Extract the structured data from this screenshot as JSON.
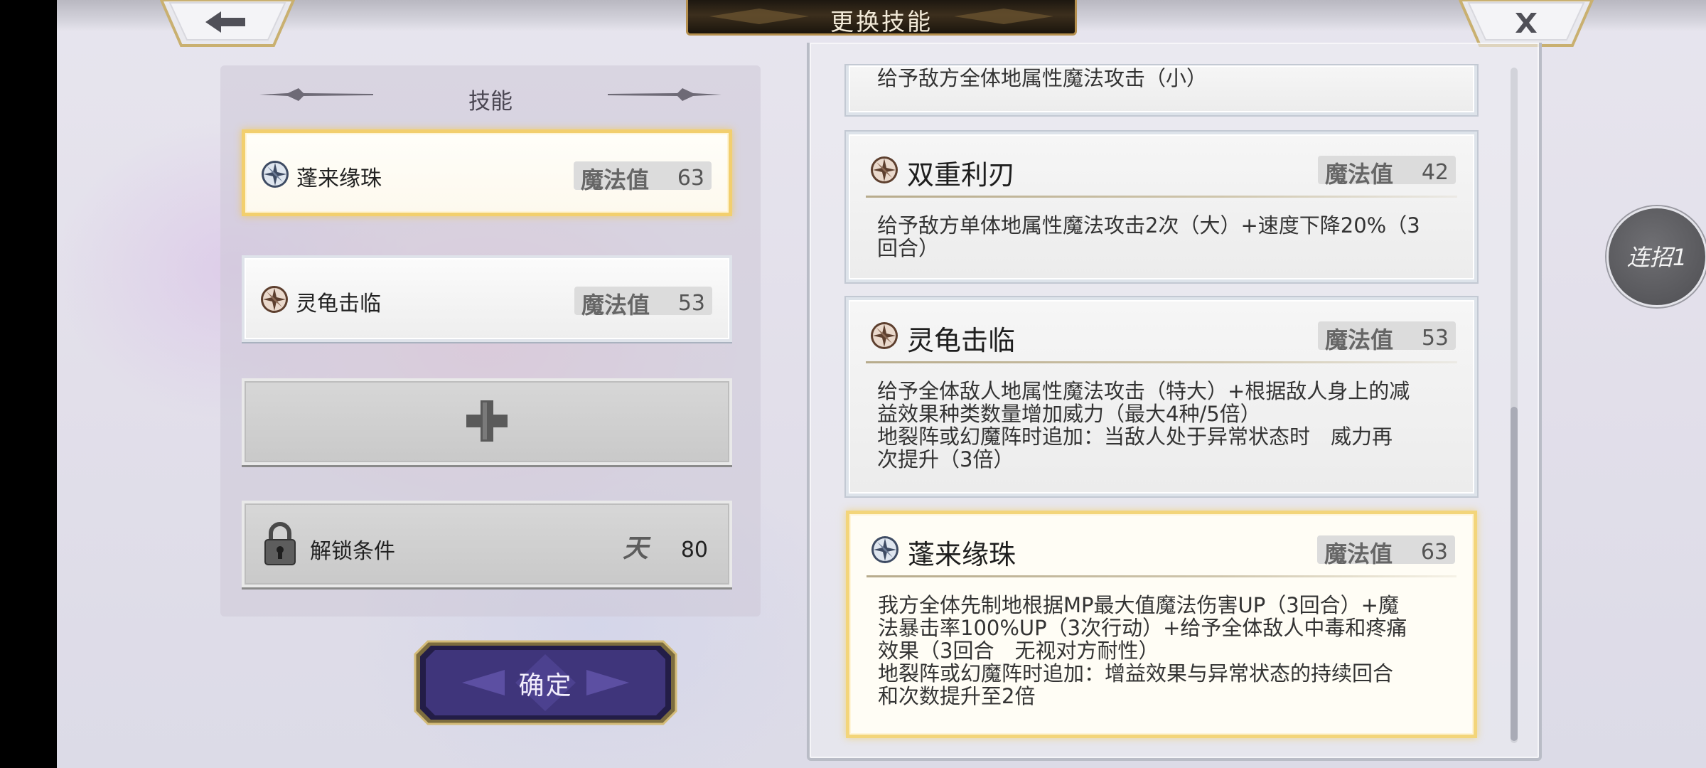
{
  "header": {
    "title": "更换技能"
  },
  "left_panel": {
    "title": "技能",
    "slots": [
      {
        "name": "蓬来缘珠",
        "mp_label": "魔法值",
        "mp": "63",
        "selected": true,
        "icon": "compass-star-blue-icon"
      },
      {
        "name": "灵龟击临",
        "mp_label": "魔法值",
        "mp": "53",
        "selected": false,
        "icon": "compass-star-brown-icon"
      }
    ],
    "add_slot": {
      "icon": "plus-icon"
    },
    "locked_slot": {
      "label": "解锁条件",
      "rank_icon": "天",
      "value": "80"
    },
    "confirm_label": "确定"
  },
  "skill_list": {
    "partial_top_desc": "给予敌方全体地属性魔法攻击（小）",
    "cards": [
      {
        "name": "双重利刃",
        "mp_label": "魔法值",
        "mp": "42",
        "icon": "compass-star-brown-icon",
        "desc": "给予敌方单体地属性魔法攻击2次（大）+速度下降20%（3\n回合）"
      },
      {
        "name": "灵龟击临",
        "mp_label": "魔法值",
        "mp": "53",
        "icon": "compass-star-brown-icon",
        "desc": "给予全体敌人地属性魔法攻击（特大）+根据敌人身上的减\n益效果种类数量增加威力（最大4种/5倍）\n地裂阵或幻魔阵时追加：当敌人处于异常状态时　威力再\n次提升（3倍）"
      },
      {
        "name": "蓬来缘珠",
        "mp_label": "魔法值",
        "mp": "63",
        "icon": "compass-star-blue-icon",
        "selected": true,
        "desc": "我方全体先制地根据MP最大值魔法伤害UP（3回合）+魔\n法暴击率100%UP（3次行动）+给予全体敌人中毒和疼痛\n效果（3回合　无视对方耐性）\n地裂阵或幻魔阵时追加：增益效果与异常状态的持续回合\n和次数提升至2倍"
      }
    ]
  },
  "combo_button": {
    "label": "连招1"
  },
  "colors": {
    "gold_border": "#f2cf6e",
    "confirm_purple": "#4b3d8f",
    "frame_gray": "#b9bcc6"
  }
}
